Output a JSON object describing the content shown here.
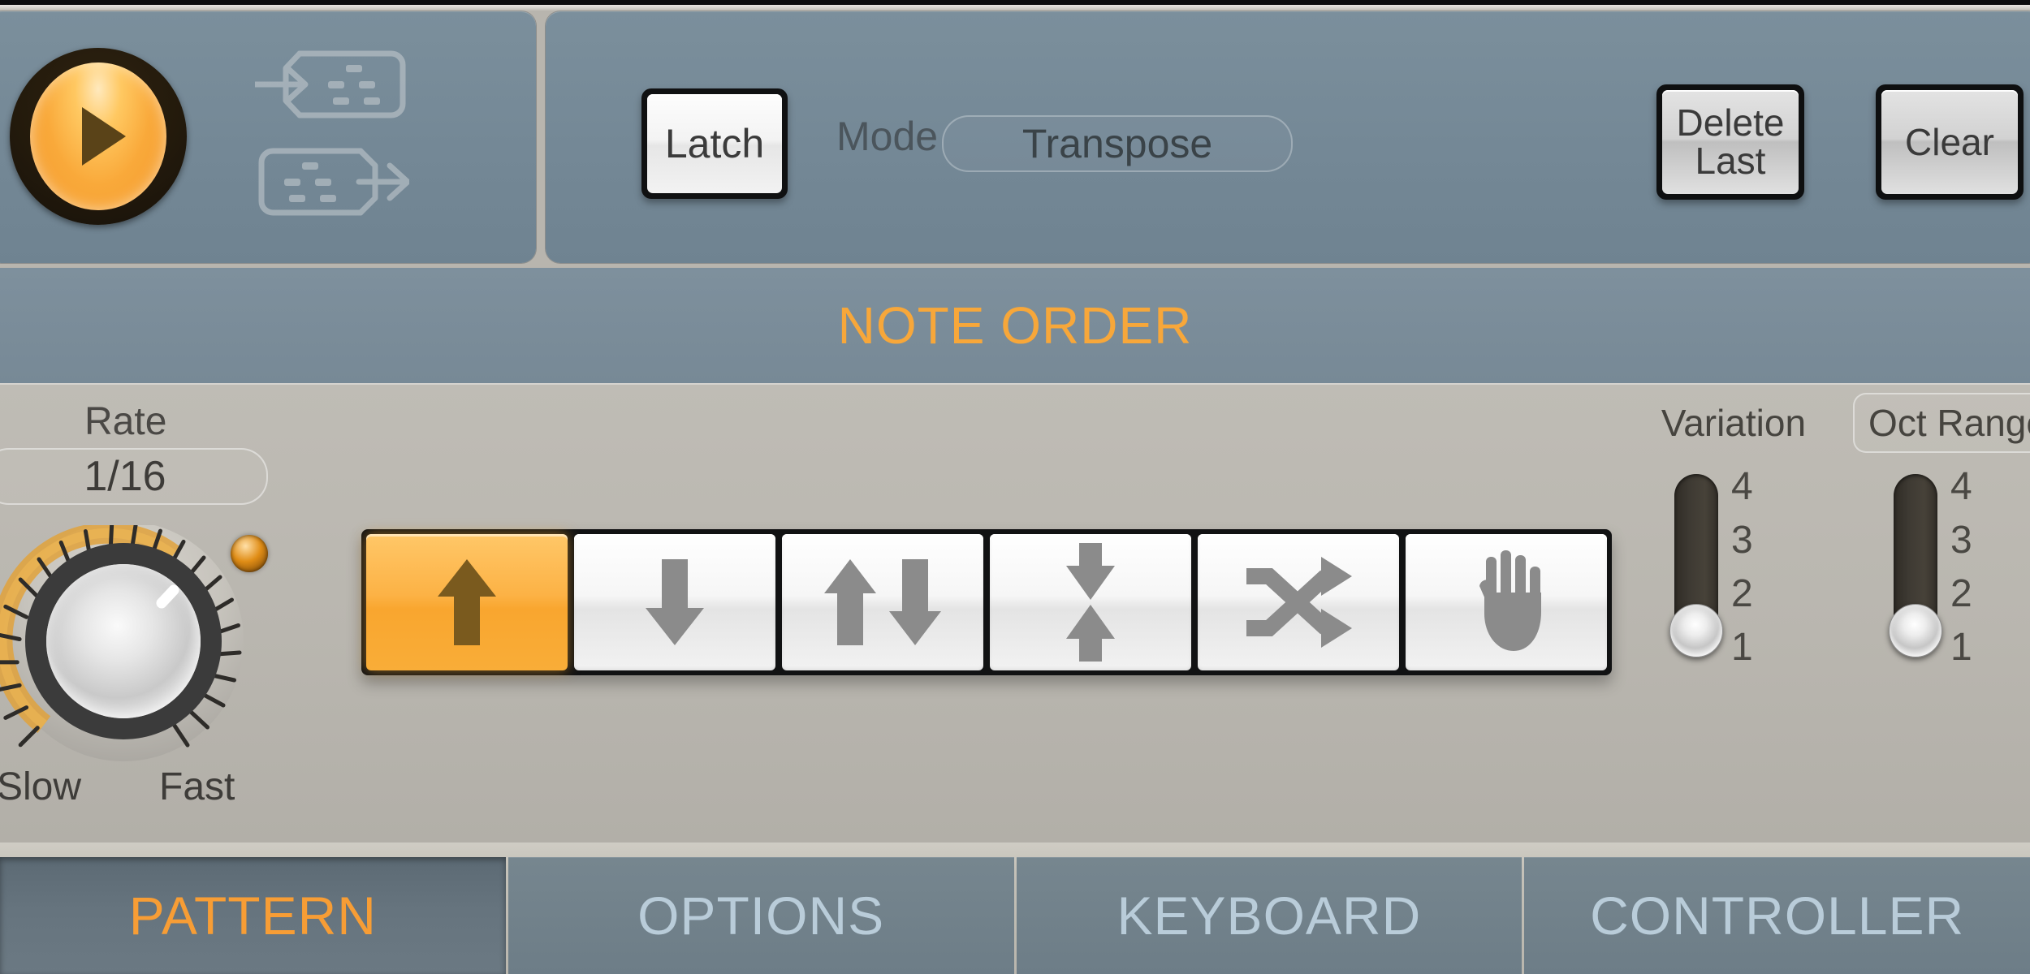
{
  "transport": {
    "play_button": "play-icon",
    "midi_in_icon": "midi-in-icon",
    "midi_out_icon": "midi-out-icon"
  },
  "header": {
    "latch_label": "Latch",
    "mode_label": "Mode",
    "mode_value": "Transpose",
    "delete_last_line1": "Delete",
    "delete_last_line2": "Last",
    "clear_label": "Clear"
  },
  "section": {
    "title": "NOTE ORDER",
    "title_color": "#f7a73a"
  },
  "rate": {
    "label": "Rate",
    "value": "1/16",
    "min_label": "Slow",
    "max_label": "Fast",
    "knob_icon": "rotary-knob-icon",
    "led_icon": "tempo-led-icon"
  },
  "note_order": {
    "selected_index": 0,
    "buttons": [
      {
        "icon": "arrow-up-icon",
        "name": "note-order-up"
      },
      {
        "icon": "arrow-down-icon",
        "name": "note-order-down"
      },
      {
        "icon": "arrow-up-down-icon",
        "name": "note-order-up-down"
      },
      {
        "icon": "arrow-converge-icon",
        "name": "note-order-inside-out"
      },
      {
        "icon": "shuffle-icon",
        "name": "note-order-random"
      },
      {
        "icon": "hand-icon",
        "name": "note-order-as-played"
      }
    ]
  },
  "variation": {
    "label": "Variation",
    "ticks": [
      "4",
      "3",
      "2",
      "1"
    ],
    "value": "1"
  },
  "oct_range": {
    "label": "Oct Range",
    "ticks": [
      "4",
      "3",
      "2",
      "1"
    ],
    "value": "1"
  },
  "tabs": [
    {
      "label": "PATTERN",
      "active": true
    },
    {
      "label": "OPTIONS",
      "active": false
    },
    {
      "label": "KEYBOARD",
      "active": false
    },
    {
      "label": "CONTROLLER",
      "active": false
    }
  ]
}
